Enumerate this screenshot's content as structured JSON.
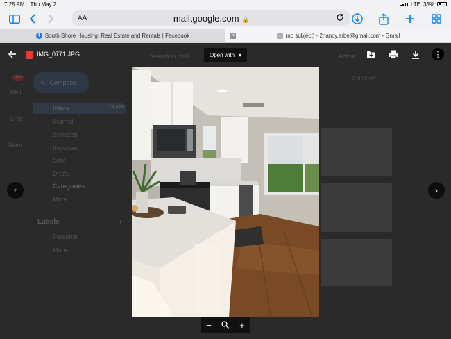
{
  "status": {
    "time": "7:25 AM",
    "date": "Thu May 2",
    "network": "LTE",
    "battery": "35%"
  },
  "browser": {
    "aa_label": "AA",
    "url": "mail.google.com",
    "tabs": [
      {
        "label": "South Shore Housing: Real Estate and Rentals | Facebook"
      },
      {
        "label": "(no subject) - 2nancy.erbe@gmail.com - Gmail"
      }
    ]
  },
  "gmail": {
    "search_placeholder": "Search in mail",
    "compose": "Compose",
    "nav": [
      {
        "label": "Inbox",
        "count": "14,474"
      },
      {
        "label": "Starred"
      },
      {
        "label": "Snoozed"
      },
      {
        "label": "Important"
      },
      {
        "label": "Sent"
      },
      {
        "label": "Drafts"
      },
      {
        "label": "Categories"
      },
      {
        "label": "More"
      }
    ],
    "rail": [
      {
        "label": "Mail",
        "badge": "99+"
      },
      {
        "label": "Chat"
      },
      {
        "label": "Meet"
      }
    ],
    "labels_heading": "Labels",
    "labels": [
      {
        "label": "Personal"
      },
      {
        "label": "More"
      }
    ],
    "pagination": "3 of 35,407",
    "active_status": "Active"
  },
  "viewer": {
    "filename": "IMG_0771.JPG",
    "open_with": "Open with",
    "icons": [
      "add-to-drive-icon",
      "print-icon",
      "download-icon",
      "more-vert-icon"
    ]
  },
  "zoom": {
    "minus": "−",
    "plus": "+"
  }
}
